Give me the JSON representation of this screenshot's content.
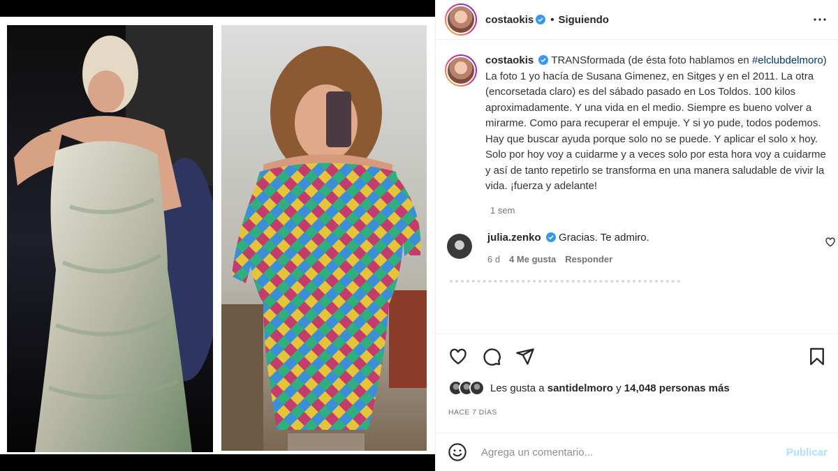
{
  "post": {
    "media": {
      "photo_1_alt": "",
      "photo_2_alt": ""
    },
    "header": {
      "username": "costaokis",
      "separator": "•",
      "follow_status": "Siguiendo"
    },
    "caption": {
      "username": "costaokis",
      "text_start": "TRANSformada (de ésta foto hablamos en",
      "hashtag": "#elclubdelmoro",
      "text_end": ") La foto 1 yo hacía de Susana Gimenez, en Sitges y en el 2011. La otra (encorsetada claro) es del sábado pasado en Los Toldos. 100 kilos aproximadamente. Y una vida en el medio. Siempre es bueno volver a mirarme. Como para recuperar el empuje. Y si yo pude, todos podemos. Hay que buscar ayuda porque solo no se puede. Y aplicar el solo x hoy. Solo por hoy voy a cuidarme y a veces solo por esta hora voy a cuidarme y así de tanto repetirlo se transforma en una manera saludable de vivir la vida. ¡fuerza y adelante!",
      "time": "1 sem"
    },
    "comments": [
      {
        "username": "julia.zenko",
        "text": "Gracias. Te admiro.",
        "time": "6 d",
        "likes": "4 Me gusta",
        "reply": "Responder"
      }
    ],
    "likes": {
      "prefix": "Les gusta a",
      "user": "santidelmoro",
      "middle": "y",
      "others": "14,048 personas más"
    },
    "posted": "HACE 7 DÍAS",
    "add_comment": {
      "placeholder": "Agrega un comentario...",
      "publish": "Publicar"
    },
    "icons": {
      "verified": "verified-badge-icon",
      "more": "more-options-icon",
      "like": "heart-icon",
      "comment": "comment-bubble-icon",
      "share": "paper-plane-icon",
      "save": "bookmark-icon",
      "emoji": "emoji-smiley-icon"
    },
    "colors": {
      "verified": "#3897f0",
      "link": "#00376b",
      "muted": "#737373",
      "publish_disabled": "#b2dffc"
    }
  }
}
